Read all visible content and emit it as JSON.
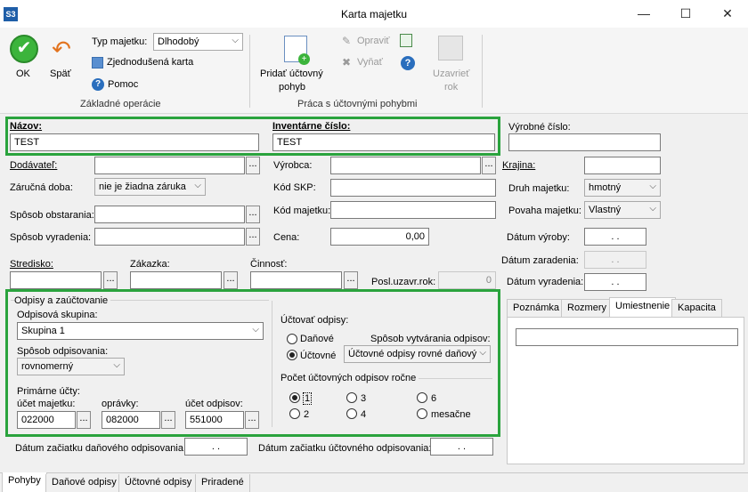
{
  "window": {
    "logo": "S3",
    "title": "Karta majetku",
    "minimize": "—",
    "maximize": "☐",
    "close": "✕"
  },
  "ribbon": {
    "ok": "OK",
    "back": "Späť",
    "asset_type_label": "Typ majetku:",
    "asset_type_value": "Dlhodobý",
    "simple_card": "Zjednodušená karta",
    "help": "Pomoc",
    "group1": "Základné operácie",
    "add_line1": "Pridať účtovný",
    "add_line2": "pohyb",
    "edit": "Opraviť",
    "remove": "Vyňať",
    "close_line1": "Uzavrieť",
    "close_line2": "rok",
    "group2": "Práca s účtovnými pohybmi"
  },
  "form": {
    "name_label": "Názov:",
    "name_value": "TEST",
    "inv_label": "Inventárne číslo:",
    "inv_value": "TEST",
    "serial_label": "Výrobné číslo:",
    "supplier_label": "Dodávateľ:",
    "manufacturer_label": "Výrobca:",
    "country_label": "Krajina:",
    "warranty_label": "Záručná doba:",
    "warranty_value": "nie je žiadna záruka",
    "skp_label": "Kód SKP:",
    "asset_kind_label": "Druh majetku:",
    "asset_kind_value": "hmotný",
    "acquire_label": "Spôsob obstarania:",
    "asset_code_label": "Kód majetku:",
    "asset_nature_label": "Povaha majetku:",
    "asset_nature_value": "Vlastný",
    "disposal_label": "Spôsob vyradenia:",
    "price_label": "Cena:",
    "price_value": "0,00",
    "prod_date_label": "Dátum výroby:",
    "incl_date_label": "Dátum zaradenia:",
    "excl_date_label": "Dátum vyradenia:",
    "date_blank": ".   .",
    "center_label": "Stredisko:",
    "order_label": "Zákazka:",
    "activity_label": "Činnosť:",
    "last_year_label": "Posl.uzavr.rok:",
    "last_year_value": "0",
    "ellipsis": "...",
    "dep_tax_start_label": "Dátum začiatku daňového odpisovania:",
    "dep_acc_start_label": "Dátum začiatku účtovného odpisovania:"
  },
  "depreciation": {
    "title": "Odpisy a zaúčtovanie",
    "group_label": "Odpisová skupina:",
    "group_value": "Skupina 1",
    "method_label": "Spôsob odpisovania:",
    "method_value": "rovnomerný",
    "primary_label": "Primárne účty:",
    "asset_acc_label": "účet majetku:",
    "asset_acc_value": "022000",
    "adj_label": "oprávky:",
    "adj_value": "082000",
    "dep_acc_label": "účet odpisov:",
    "dep_acc_value": "551000",
    "post_label": "Účtovať odpisy:",
    "tax_label": "Daňové",
    "acc_label": "Účtovné",
    "create_label": "Spôsob vytvárania odpisov:",
    "create_value": "Účtovné odpisy rovné daňový",
    "count_label": "Počet účtovných odpisov ročne",
    "o1": "1",
    "o2": "2",
    "o3": "3",
    "o4": "4",
    "o6": "6",
    "om": "mesačne"
  },
  "side_tabs": [
    "Poznámka",
    "Rozmery",
    "Umiestnenie",
    "Kapacita"
  ],
  "bottom_tabs": [
    "Pohyby",
    "Daňové odpisy",
    "Účtovné odpisy",
    "Priradené"
  ],
  "icons": [
    "check-icon",
    "back-arrow-icon",
    "card-icon",
    "help-icon",
    "add-document-icon",
    "edit-icon",
    "export-icon",
    "delete-icon",
    "close-year-icon",
    "dropdown-arrow-icon"
  ]
}
